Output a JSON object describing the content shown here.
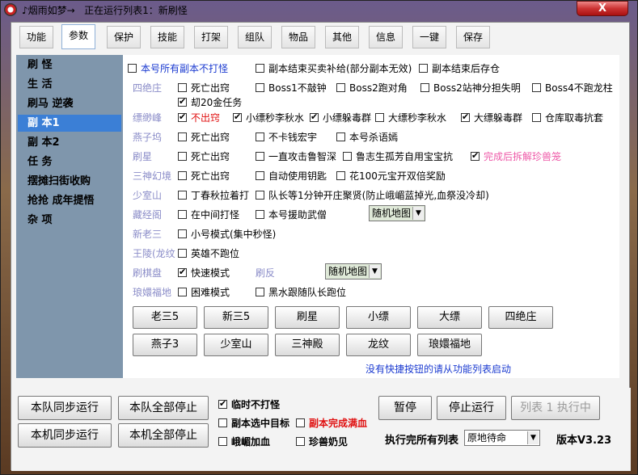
{
  "title": {
    "text": "♪烟雨如梦→   正在运行列表1：新刷怪",
    "close": "X"
  },
  "tabs": [
    "功能",
    "参数",
    "保护",
    "技能",
    "打架",
    "组队",
    "物品",
    "其他",
    "信息",
    "一键",
    "保存"
  ],
  "sidebar": [
    "刷 怪",
    "生 活",
    "刷马 逆袭",
    "副 本1",
    "副 本2",
    "任 务",
    "摆摊扫街收购",
    "抢抢 成年提悟",
    "杂 项"
  ],
  "top_options": [
    "本号所有副本不打怪",
    "副本结束买卖补给(部分副本无效)",
    "副本结束后存仓"
  ],
  "sections": {
    "siju": {
      "label": "四绝庄",
      "opts": [
        "死亡出窍",
        "Boss1不敲钟",
        "Boss2跑对角",
        "Boss2站神分担失明",
        "Boss4不跑龙柱",
        "刧20金任务"
      ]
    },
    "piao": {
      "label": "缥缈峰",
      "opts": [
        "不出窍",
        "小缥秒李秋水",
        "小缥躲毒群",
        "大缥秒李秋水",
        "大缥躲毒群",
        "仓库取毒抗套"
      ]
    },
    "yanzi": {
      "label": "燕子坞",
      "opts": [
        "死亡出窍",
        "不卡钱宏宇",
        "本号杀语嫣"
      ]
    },
    "shuaxing": {
      "label": "刷星",
      "opts": [
        "死亡出窍",
        "一直攻击鲁智深",
        "鲁志生孤芳自用宝宝抗",
        "完成后拆解珍兽笼"
      ]
    },
    "sanshen": {
      "label": "三神幻境",
      "opts": [
        "死亡出窍",
        "自动使用钥匙",
        "花100元宝开双倍奖励"
      ]
    },
    "shaoshi": {
      "label": "少室山",
      "opts": [
        "丁春秋拉着打",
        "队长等1分钟开庄聚贤(防止峨嵋蓝掉光,血祭没冷却)"
      ]
    },
    "cangjing": {
      "label": "藏经阁",
      "opts": [
        "在中间打怪",
        "本号援助武僧"
      ],
      "dropdown": "随机地图"
    },
    "xinsan": {
      "label": "新老三",
      "opts": [
        "小号模式(集中秒怪)"
      ]
    },
    "wangling": {
      "label": "王陵(龙纹",
      "opts": [
        "英雄不跑位"
      ]
    },
    "qipan": {
      "label": "刷棋盘",
      "opts": [
        "快速模式"
      ],
      "label2": "刷反",
      "dropdown": "随机地图"
    },
    "langhuan": {
      "label": "琅嬛福地",
      "opts": [
        "困难模式",
        "黑水跟随队长跑位"
      ]
    }
  },
  "quick_buttons": [
    "老三5",
    "新三5",
    "刷星",
    "小缥",
    "大缥",
    "四绝庄",
    "燕子3",
    "少室山",
    "三神殿",
    "龙纹",
    "琅嬛福地"
  ],
  "hint": "没有快捷按钮的请从功能列表启动",
  "bottom": {
    "team_sync": "本队同步运行",
    "team_stop": "本队全部停止",
    "local_sync": "本机同步运行",
    "local_stop": "本机全部停止",
    "opt_temp": "临时不打怪",
    "opt_target": "副本选中目标",
    "opt_done": "副本完成满血",
    "opt_emei": "峨嵋加血",
    "opt_pet": "珍兽奶见",
    "pause": "暂停",
    "stop": "停止运行",
    "run_list": "列表 1 执行中",
    "after_label": "执行完所有列表",
    "after_value": "原地待命",
    "version": "版本V3.23"
  }
}
